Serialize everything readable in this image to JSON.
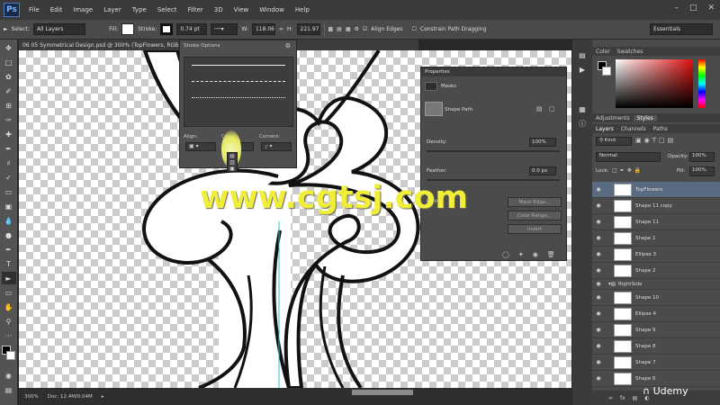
{
  "menu": {
    "logo": "Ps",
    "items": [
      "File",
      "Edit",
      "Image",
      "Layer",
      "Type",
      "Select",
      "Filter",
      "3D",
      "View",
      "Window",
      "Help"
    ]
  },
  "options": {
    "select_label": "Select:",
    "select_value": "All Layers",
    "fill_label": "Fill:",
    "stroke_label": "Stroke:",
    "stroke_width": "0.74 pt",
    "w_label": "W:",
    "w_value": "118.06",
    "h_label": "H:",
    "h_value": "221.97",
    "align_edges": "Align Edges",
    "constrain": "Constrain Path Dragging",
    "workspace": "Essentials"
  },
  "doc": {
    "tab_title": "06 05 Symmetrical Design.psd @ 300% (TopFlowers, RGB",
    "zoom": "300%",
    "doc_size": "Doc: 12.4M/0.04M"
  },
  "stroke_popup": {
    "title": "Stroke Options",
    "align_label": "Align:",
    "caps_label": "Caps:",
    "corners_label": "Corners:"
  },
  "properties": {
    "title": "Properties",
    "sub": "Masks",
    "shape_path": "Shape Path",
    "density_label": "Density:",
    "density_value": "100%",
    "feather_label": "Feather:",
    "feather_value": "0.0 px",
    "refine_label": "Refine:",
    "mask_edge": "Mask Edge...",
    "color_range": "Color Range...",
    "invert": "Invert"
  },
  "right": {
    "color_tab": "Color",
    "swatches_tab": "Swatches",
    "adjustments_tab": "Adjustments",
    "styles_tab": "Styles",
    "layers_tab": "Layers",
    "channels_tab": "Channels",
    "paths_tab": "Paths",
    "kind": "Kind",
    "blend_mode": "Normal",
    "opacity_label": "Opacity:",
    "opacity_value": "100%",
    "lock_label": "Lock:",
    "fill_label": "Fill:",
    "fill_value": "100%"
  },
  "layers": [
    "TopFlowers",
    "Shape 11 copy",
    "Shape 11",
    "Shape 1",
    "Ellipse 3",
    "Shape 2",
    "RightSide",
    "Shape 10",
    "Ellipse 4",
    "Shape 9",
    "Shape 8",
    "Shape 7",
    "Shape 6"
  ],
  "watermark": "www.cgtsj.com",
  "udemy": "Udemy"
}
